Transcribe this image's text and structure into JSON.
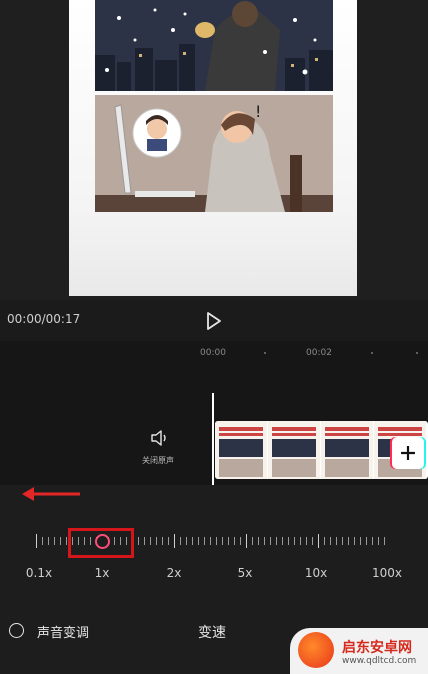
{
  "player": {
    "time": "00:00/00:17"
  },
  "timeline": {
    "ruler": [
      "00:00",
      "00:02"
    ],
    "mute_label": "关闭原声",
    "add_symbol": "+"
  },
  "speed": {
    "title": "变速",
    "labels": [
      "0.1x",
      "1x",
      "2x",
      "5x",
      "10x",
      "100x"
    ],
    "selected": "1x",
    "voice_change_label": "声音变调"
  },
  "watermark": {
    "title": "启东安卓网",
    "url": "www.qdltcd.com"
  },
  "colors": {
    "accent": "#ff4d79",
    "highlight": "#d4161b",
    "arrow": "#e32626"
  }
}
